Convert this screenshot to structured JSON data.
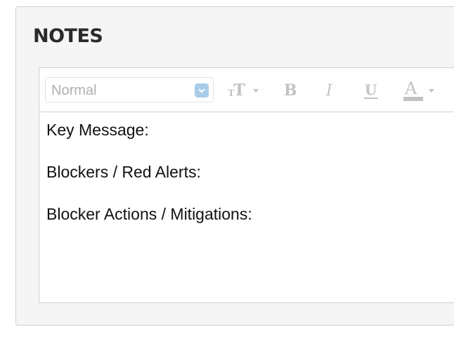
{
  "panel": {
    "title": "NOTES"
  },
  "toolbar": {
    "format_select": {
      "selected": "Normal",
      "caret_icon": "chevron-down-icon"
    },
    "tools": [
      {
        "name": "text-size",
        "icon": "text-size-icon"
      },
      {
        "name": "bold",
        "icon": "bold-icon",
        "glyph": "B"
      },
      {
        "name": "italic",
        "icon": "italic-icon",
        "glyph": "I"
      },
      {
        "name": "underline",
        "icon": "underline-icon",
        "glyph": "U"
      },
      {
        "name": "text-color",
        "icon": "text-color-icon",
        "glyph": "A"
      }
    ]
  },
  "editor": {
    "lines": [
      "Key Message:",
      "Blockers / Red Alerts:",
      "Blocker Actions / Mitigations:"
    ]
  },
  "colors": {
    "panel_bg": "#f5f5f5",
    "toolbar_icon": "#c2c2c2",
    "select_caret": "#a9cce8",
    "text": "#111111"
  }
}
